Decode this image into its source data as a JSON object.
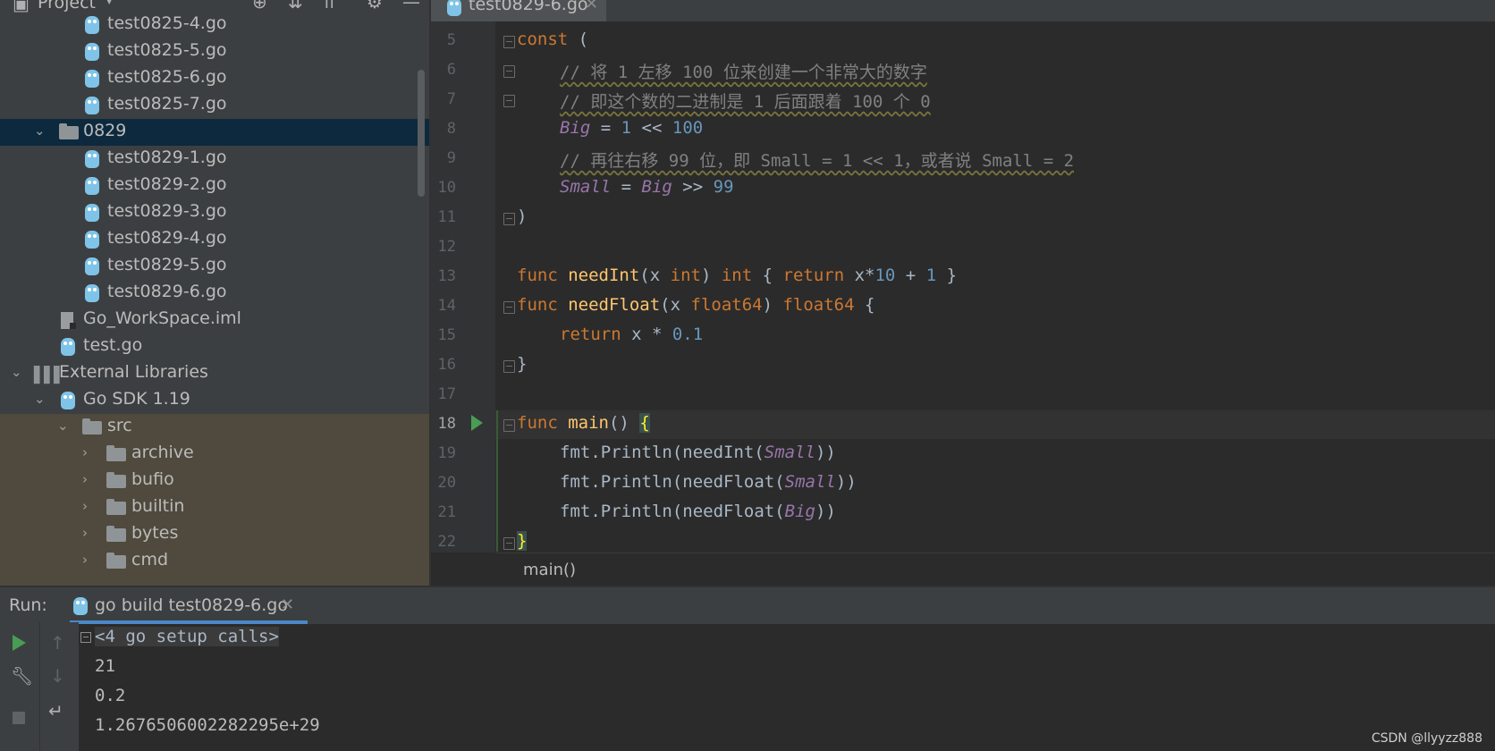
{
  "project_panel": {
    "title": "Project",
    "rows": [
      {
        "label": "test0825-4.go"
      },
      {
        "label": "test0825-5.go"
      },
      {
        "label": "test0825-6.go"
      },
      {
        "label": "test0825-7.go"
      },
      {
        "label": "0829"
      },
      {
        "label": "test0829-1.go"
      },
      {
        "label": "test0829-2.go"
      },
      {
        "label": "test0829-3.go"
      },
      {
        "label": "test0829-4.go"
      },
      {
        "label": "test0829-5.go"
      },
      {
        "label": "test0829-6.go"
      },
      {
        "label": "Go_WorkSpace.iml"
      },
      {
        "label": "test.go"
      },
      {
        "label": "External Libraries"
      },
      {
        "label": "Go SDK 1.19"
      },
      {
        "label": "src"
      },
      {
        "label": "archive"
      },
      {
        "label": "bufio"
      },
      {
        "label": "builtin"
      },
      {
        "label": "bytes"
      },
      {
        "label": "cmd"
      }
    ]
  },
  "editor": {
    "active_tab": "test0829-6.go",
    "line_numbers": [
      "5",
      "6",
      "7",
      "8",
      "9",
      "10",
      "11",
      "12",
      "13",
      "14",
      "15",
      "16",
      "17",
      "18",
      "19",
      "20",
      "21",
      "22"
    ],
    "breadcrumb": "main()"
  },
  "code": {
    "l5": {
      "kw": "const",
      "rest": " ("
    },
    "l6": {
      "comment": "// 将 1 左移 100 位来创建一个非常大的数字"
    },
    "l7": {
      "comment": "// 即这个数的二进制是 1 后面跟着 100 个 0"
    },
    "l8": {
      "name": "Big",
      "op": " = ",
      "n1": "1",
      "op2": " << ",
      "n2": "100"
    },
    "l9": {
      "comment": "// 再往右移 99 位，即 Small = 1 << 1，或者说 Small = 2"
    },
    "l10": {
      "name": "Small",
      "op": " = ",
      "ref": "Big",
      "op2": " >> ",
      "n": "99"
    },
    "l11": {
      "text": ")"
    },
    "l13": {
      "kw": "func",
      "fn": "needInt",
      "p1": "(x ",
      "t1": "int",
      "p2": ") ",
      "t2": "int",
      "p3": " { ",
      "kw2": "return",
      "p4": " x*",
      "n1": "10",
      "p5": " + ",
      "n2": "1",
      "p6": " }"
    },
    "l14": {
      "kw": "func",
      "fn": "needFloat",
      "p1": "(x ",
      "t1": "float64",
      "p2": ") ",
      "t2": "float64",
      "p3": " {"
    },
    "l15": {
      "kw": "return",
      "rest": " x * ",
      "n": "0.1"
    },
    "l16": {
      "text": "}"
    },
    "l18": {
      "kw": "func",
      "fn": "main",
      "p": "() ",
      "brace": "{"
    },
    "l19": {
      "a": "fmt.Println(needInt(",
      "c": "Small",
      "b": "))"
    },
    "l20": {
      "a": "fmt.Println(needFloat(",
      "c": "Small",
      "b": "))"
    },
    "l21": {
      "a": "fmt.Println(needFloat(",
      "c": "Big",
      "b": "))"
    },
    "l22": {
      "brace": "}"
    }
  },
  "run_panel": {
    "label": "Run:",
    "tab": "go build test0829-6.go",
    "output": [
      "<4 go setup calls>",
      "21",
      "0.2",
      "1.2676506002282295e+29"
    ]
  },
  "watermark": "CSDN @llyyzz888"
}
